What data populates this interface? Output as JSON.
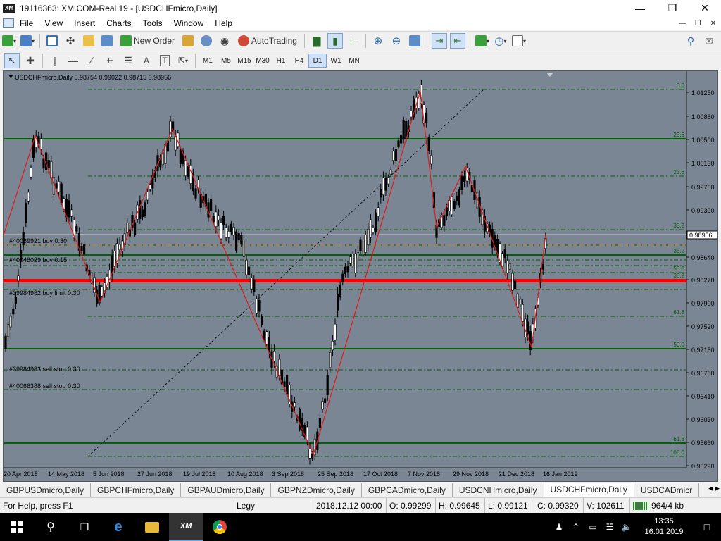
{
  "window": {
    "title": "19116363: XM.COM-Real 19 - [USDCHFmicro,Daily]",
    "logo_text": "XM"
  },
  "menu": [
    "File",
    "View",
    "Insert",
    "Charts",
    "Tools",
    "Window",
    "Help"
  ],
  "toolbar": {
    "new_order_label": "New Order",
    "autotrading_label": "AutoTrading"
  },
  "timeframes": [
    "M1",
    "M5",
    "M15",
    "M30",
    "H1",
    "H4",
    "D1",
    "W1",
    "MN"
  ],
  "active_timeframe": "D1",
  "chart": {
    "header": "USDCHFmicro,Daily  0.98754 0.99022 0.98715 0.98956",
    "price_labels": [
      "1.01250",
      "1.00880",
      "1.00500",
      "1.00130",
      "0.99760",
      "0.99390",
      "0.99020",
      "0.98640",
      "0.98270",
      "0.97900",
      "0.97520",
      "0.97150",
      "0.96780",
      "0.96410",
      "0.96030",
      "0.95660",
      "0.95290"
    ],
    "current_price": "0.98956",
    "date_labels": [
      "20 Apr 2018",
      "14 May 2018",
      "5 Jun 2018",
      "27 Jun 2018",
      "19 Jul 2018",
      "10 Aug 2018",
      "3 Sep 2018",
      "25 Sep 2018",
      "17 Oct 2018",
      "7 Nov 2018",
      "29 Nov 2018",
      "21 Dec 2018",
      "16 Jan 2019"
    ],
    "fib_labels": [
      "0.0",
      "23.6",
      "23.6",
      "38.2",
      "38.2",
      "50.0",
      "38.2",
      "61.8",
      "50.0",
      "61.8",
      "100.0"
    ],
    "orders": [
      "#40069921 buy 0.30",
      "#40048029 buy 0.15",
      "#39984982 buy limit 0.30",
      "#39984983 sell stop 0.30",
      "#40066388 sell stop 0.30"
    ],
    "colors": {
      "background": "#7b8694",
      "fib": "#006400",
      "zigzag": "#e11a1a",
      "order_line": "#ff0000"
    }
  },
  "tabs": [
    "GBPUSDmicro,Daily",
    "GBPCHFmicro,Daily",
    "GBPAUDmicro,Daily",
    "GBPNZDmicro,Daily",
    "GBPCADmicro,Daily",
    "USDCNHmicro,Daily",
    "USDCHFmicro,Daily",
    "USDCADmicr"
  ],
  "active_tab": "USDCHFmicro,Daily",
  "status": {
    "help": "For Help, press F1",
    "profile": "Legy",
    "datetime": "2018.12.12 00:00",
    "open": "O: 0.99299",
    "high": "H: 0.99645",
    "low": "L: 0.99121",
    "close": "C: 0.99320",
    "volume": "V: 102611",
    "traffic": "964/4 kb"
  },
  "taskbar": {
    "time": "13:35",
    "date": "16.01.2019"
  }
}
